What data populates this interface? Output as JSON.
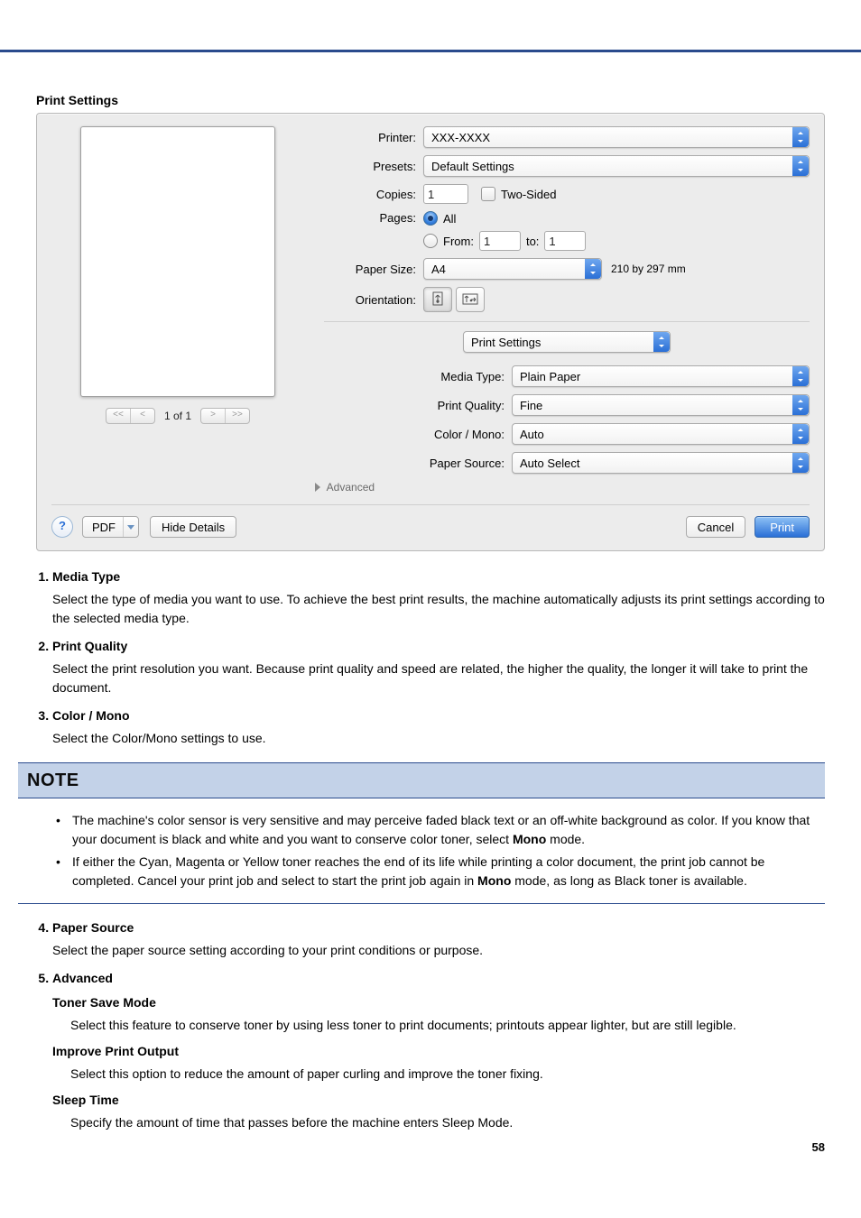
{
  "section_title": "Print Settings",
  "dialog": {
    "labels": {
      "printer": "Printer:",
      "presets": "Presets:",
      "copies": "Copies:",
      "two_sided": "Two-Sided",
      "pages": "Pages:",
      "all": "All",
      "from": "From:",
      "to": "to:",
      "paper_size": "Paper Size:",
      "paper_dim": "210 by 297 mm",
      "orientation": "Orientation:",
      "section_dd": "Print Settings",
      "media_type": "Media Type:",
      "print_quality": "Print Quality:",
      "color_mono": "Color / Mono:",
      "paper_source": "Paper Source:",
      "advanced": "Advanced",
      "pdf": "PDF",
      "hide_details": "Hide Details",
      "cancel": "Cancel",
      "print": "Print"
    },
    "values": {
      "printer": "XXX-XXXX",
      "presets": "Default Settings",
      "copies": "1",
      "from": "1",
      "to": "1",
      "paper_size": "A4",
      "media_type": "Plain Paper",
      "print_quality": "Fine",
      "color_mono": "Auto",
      "paper_source": "Auto Select"
    },
    "pager": {
      "first": "<<",
      "prev": "<",
      "text": "1 of 1",
      "next": ">",
      "last": ">>"
    }
  },
  "list": {
    "1": {
      "title": "Media Type",
      "desc": "Select the type of media you want to use. To achieve the best print results, the machine automatically adjusts its print settings according to the selected media type."
    },
    "2": {
      "title": "Print Quality",
      "desc": "Select the print resolution you want. Because print quality and speed are related, the higher the quality, the longer it will take to print the document."
    },
    "3": {
      "title": "Color / Mono",
      "desc": "Select the Color/Mono settings to use."
    },
    "4": {
      "title": "Paper Source",
      "desc": "Select the paper source setting according to your print conditions or purpose."
    },
    "5": {
      "title": "Advanced",
      "sub": {
        "a": {
          "title": "Toner Save Mode",
          "desc": "Select this feature to conserve toner by using less toner to print documents; printouts appear lighter, but are still legible."
        },
        "b": {
          "title": "Improve Print Output",
          "desc": "Select this option to reduce the amount of paper curling and improve the toner fixing."
        },
        "c": {
          "title": "Sleep Time",
          "desc": "Specify the amount of time that passes before the machine enters Sleep Mode."
        }
      }
    }
  },
  "note": {
    "head": "NOTE",
    "b1a": "The machine's color sensor is very sensitive and may perceive faded black text or an off-white background as color. If you know that your document is black and white and you want to conserve color toner, select ",
    "b1b": "Mono",
    "b1c": " mode.",
    "b2a": "If either the Cyan, Magenta or Yellow toner reaches the end of its life while printing a color document, the print job cannot be completed. Cancel your print job and select to start the print job again in ",
    "b2b": "Mono",
    "b2c": " mode, as long as Black toner is available."
  },
  "page_number": "58"
}
